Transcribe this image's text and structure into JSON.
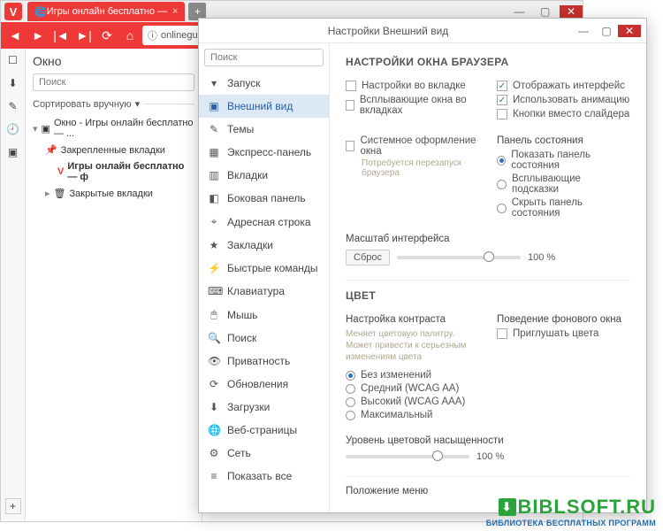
{
  "browser": {
    "tab_title": "Игры онлайн бесплатно —",
    "address": "onlineguru.ru",
    "panel": {
      "title": "Окно",
      "search_placeholder": "Поиск",
      "sort_label": "Сортировать вручную",
      "tree": {
        "root": "Окно - Игры онлайн бесплатно — ...",
        "pinned": "Закрепленные вкладки",
        "active": "Игры онлайн бесплатно — ф",
        "closed": "Закрытые вкладки"
      }
    }
  },
  "settings": {
    "window_title": "Настройки Внешний вид",
    "search_placeholder": "Поиск",
    "nav": [
      {
        "icon": "▾",
        "label": "Запуск"
      },
      {
        "icon": "▣",
        "label": "Внешний вид"
      },
      {
        "icon": "✎",
        "label": "Темы"
      },
      {
        "icon": "▦",
        "label": "Экспресс-панель"
      },
      {
        "icon": "▥",
        "label": "Вкладки"
      },
      {
        "icon": "◧",
        "label": "Боковая панель"
      },
      {
        "icon": "⌖",
        "label": "Адресная строка"
      },
      {
        "icon": "★",
        "label": "Закладки"
      },
      {
        "icon": "⚡",
        "label": "Быстрые команды"
      },
      {
        "icon": "⌨",
        "label": "Клавиатура"
      },
      {
        "icon": "🖱",
        "label": "Мышь"
      },
      {
        "icon": "🔍",
        "label": "Поиск"
      },
      {
        "icon": "👁",
        "label": "Приватность"
      },
      {
        "icon": "⟳",
        "label": "Обновления"
      },
      {
        "icon": "⬇",
        "label": "Загрузки"
      },
      {
        "icon": "🌐",
        "label": "Веб-страницы"
      },
      {
        "icon": "⚙",
        "label": "Сеть"
      },
      {
        "icon": "≡",
        "label": "Показать все"
      }
    ],
    "active_index": 1,
    "content": {
      "section1_title": "НАСТРОЙКИ ОКНА БРАУЗЕРА",
      "left_checks": [
        {
          "label": "Настройки во вкладке",
          "checked": false
        },
        {
          "label": "Всплывающие окна во вкладках",
          "checked": false
        }
      ],
      "right_checks": [
        {
          "label": "Отображать интерфейс",
          "checked": true
        },
        {
          "label": "Использовать анимацию",
          "checked": true
        },
        {
          "label": "Кнопки вместо слайдера",
          "checked": false
        }
      ],
      "sys_theme": {
        "label": "Системное оформление окна",
        "hint": "Потребуется перезапуск браузера",
        "checked": false
      },
      "statusbar": {
        "title": "Панель состояния",
        "options": [
          "Показать панель состояния",
          "Всплывающие подсказки",
          "Скрыть панель состояния"
        ],
        "selected": 0
      },
      "ui_scale": {
        "label": "Масштаб интерфейса",
        "reset": "Сброс",
        "value": "100 %",
        "pos": 70
      },
      "section2_title": "ЦВЕТ",
      "contrast": {
        "title": "Настройка контраста",
        "desc": "Меняет цветовую палитру. Может привести к серьезным изменениям цвета",
        "options": [
          "Без изменений",
          "Средний (WCAG AA)",
          "Высокий (WCAG AAA)",
          "Максимальный"
        ],
        "selected": 0
      },
      "bgwin": {
        "title": "Поведение фонового окна",
        "label": "Приглушать цвета",
        "checked": false
      },
      "satur": {
        "label": "Уровень цветовой насыщенности",
        "value": "100 %",
        "pos": 70
      },
      "section3_title": "Положение меню"
    }
  },
  "watermark": {
    "l1": "BIBLSOFT.RU",
    "l2": "БИБЛИОТЕКА БЕСПЛАТНЫХ ПРОГРАММ"
  }
}
